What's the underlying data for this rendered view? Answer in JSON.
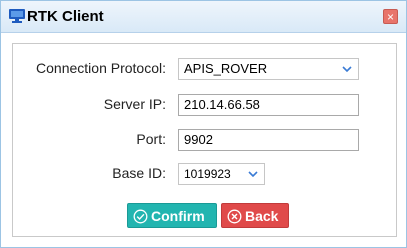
{
  "dialog": {
    "title": "RTK Client",
    "title_icon": "monitor-icon",
    "close_icon": "close-icon"
  },
  "form": {
    "protocol_label": "Connection Protocol:",
    "protocol_value": "APIS_ROVER",
    "server_ip_label": "Server IP:",
    "server_ip_value": "210.14.66.58",
    "port_label": "Port:",
    "port_value": "9902",
    "base_id_label": "Base ID:",
    "base_id_value": "1019923"
  },
  "buttons": {
    "confirm_label": "Confirm",
    "confirm_icon": "check-circle-icon",
    "back_label": "Back",
    "back_icon": "x-circle-icon"
  },
  "colors": {
    "confirm_bg": "#22b5b0",
    "back_bg": "#e04a4a",
    "title_accent": "#1e5bbf",
    "close_bg": "#e8746b"
  }
}
